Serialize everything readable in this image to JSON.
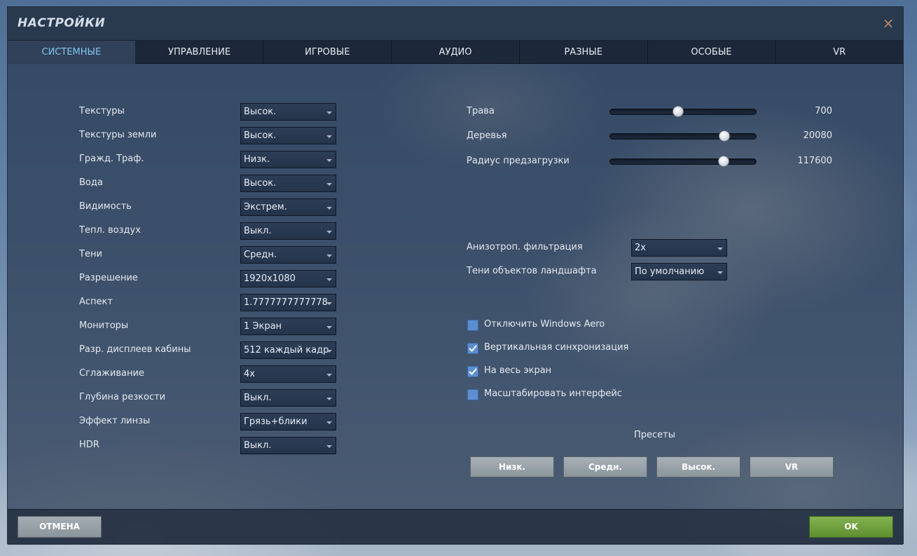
{
  "window": {
    "title": "НАСТРОЙКИ",
    "close_glyph": "×"
  },
  "tabs": [
    {
      "label": "СИСТЕМНЫЕ",
      "active": true
    },
    {
      "label": "УПРАВЛЕНИЕ"
    },
    {
      "label": "ИГРОВЫЕ"
    },
    {
      "label": "АУДИО"
    },
    {
      "label": "РАЗНЫЕ"
    },
    {
      "label": "ОСОБЫЕ"
    },
    {
      "label": "VR"
    }
  ],
  "left_settings": [
    {
      "label": "Текстуры",
      "value": "Высок."
    },
    {
      "label": "Текстуры земли",
      "value": "Высок."
    },
    {
      "label": "Гражд. Траф.",
      "value": "Низк."
    },
    {
      "label": "Вода",
      "value": "Высок."
    },
    {
      "label": "Видимость",
      "value": "Экстрем."
    },
    {
      "label": "Тепл. воздух",
      "value": "Выкл."
    },
    {
      "label": "Тени",
      "value": "Средн."
    },
    {
      "label": "Разрешение",
      "value": "1920x1080"
    },
    {
      "label": "Аспект",
      "value": "1.7777777777778"
    },
    {
      "label": "Мониторы",
      "value": "1 Экран"
    },
    {
      "label": "Разр. дисплеев кабины",
      "value": "512 каждый кадр"
    },
    {
      "label": "Сглаживание",
      "value": "4x"
    },
    {
      "label": "Глубина резкости",
      "value": "Выкл."
    },
    {
      "label": "Эффект линзы",
      "value": "Грязь+блики"
    },
    {
      "label": "HDR",
      "value": "Выкл."
    }
  ],
  "sliders": [
    {
      "label": "Трава",
      "value": "700",
      "fraction": 0.46
    },
    {
      "label": "Деревья",
      "value": "20080",
      "fraction": 0.775
    },
    {
      "label": "Радиус предзагрузки",
      "value": "117600",
      "fraction": 0.77
    }
  ],
  "right_selects": [
    {
      "label": "Анизотроп. фильтрация",
      "value": "2x"
    },
    {
      "label": "Тени объектов ландшафта",
      "value": "По умолчанию"
    }
  ],
  "checkboxes": [
    {
      "label": "Отключить Windows Aero",
      "checked": false
    },
    {
      "label": "Вертикальная синхронизация",
      "checked": true
    },
    {
      "label": "На весь экран",
      "checked": true
    },
    {
      "label": "Масштабировать интерфейс",
      "checked": false
    }
  ],
  "presets": {
    "title": "Пресеты",
    "buttons": [
      "Низк.",
      "Средн.",
      "Высок.",
      "VR"
    ]
  },
  "footer": {
    "cancel_label": "ОТМЕНА",
    "ok_label": "OK"
  },
  "colors": {
    "active_tab_text": "#7fc6ef",
    "checkbox": "#5d8ed0",
    "ok_button": "#6f9f3f",
    "cancel_button": "#97a1a8",
    "close_icon": "#b98a6a"
  }
}
